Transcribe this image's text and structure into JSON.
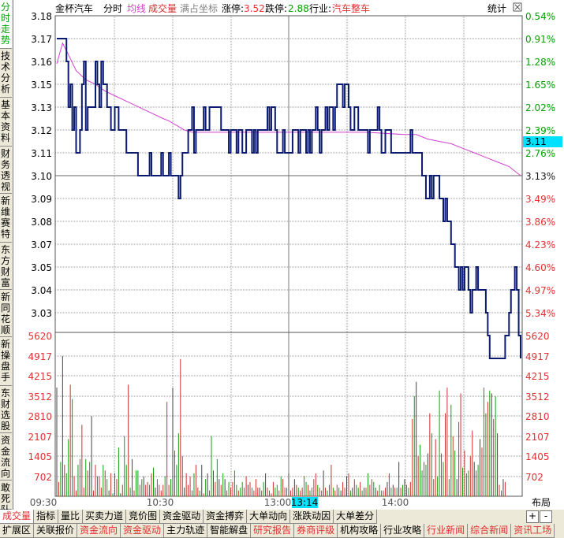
{
  "header": {
    "stock_name": "金杯汽车",
    "view": "分时",
    "avg_line_label": "均线",
    "volume_label": "成交量",
    "fill_coord_label": "满占坐标",
    "limit_up_label": "涨停:",
    "limit_up_value": "3.52",
    "limit_down_label": "跌停:",
    "limit_down_value": "2.88",
    "industry_label": "行业:",
    "industry_value": "汽车整车",
    "stats_label": "统计",
    "layout_label": "布局",
    "plus": "+",
    "minus": "-"
  },
  "side_tabs": [
    "分时走势",
    "技术分析",
    "基本资料",
    "财务透视",
    "新维赛特",
    "东方财富",
    "新同花顺",
    "新操盘手",
    "东财选股",
    "资金流向",
    "敢死队"
  ],
  "bottom_tabs_row1": [
    "成交量",
    "指标",
    "量比",
    "买卖力道",
    "竞价图",
    "资金驱动",
    "资金搏弈",
    "大单动向",
    "涨跌动因",
    "大单差分"
  ],
  "bottom_tabs_row2": [
    "扩展区",
    "关联报价",
    "资金流向",
    "资金驱动",
    "主力轨迹",
    "智能解盘",
    "研究报告",
    "券商评级",
    "机构攻略",
    "行业攻略",
    "行业新闻",
    "综合新闻",
    "资讯工场"
  ],
  "colors": {
    "price_line": "#0a1a6e",
    "avg_line": "#d040d0",
    "up_axis": "#e03030",
    "down_axis": "#00a000",
    "prev_close_axis": "#1a1a1a",
    "vol_up": "#d03030",
    "vol_down": "#10a010",
    "vol_flat": "#444444",
    "current_tag": "#00e0ff"
  },
  "chart_data": {
    "type": "line",
    "title": "",
    "prev_close": "3.10",
    "current_price_tag": "3.11",
    "price_axis_labels": [
      "3.18",
      "3.17",
      "3.16",
      "3.15",
      "3.13",
      "3.12",
      "3.11",
      "3.10",
      "3.09",
      "3.08",
      "3.07",
      "3.05",
      "3.04",
      "3.03"
    ],
    "pct_axis_labels": [
      "0.54%",
      "0.91%",
      "1.28%",
      "1.65%",
      "2.02%",
      "2.39%",
      "2.76%",
      "3.13%",
      "3.49%",
      "3.86%",
      "4.23%",
      "4.60%",
      "4.97%",
      "5.34%"
    ],
    "volume_axis_labels": [
      "5620",
      "4917",
      "4215",
      "3512",
      "2810",
      "2107",
      "1405",
      "702"
    ],
    "volume_max": 5620,
    "time_labels": [
      "09:30",
      "10:30",
      "13:00",
      "14:00"
    ],
    "cursor_time_label": "13:14",
    "minutes_total": 240,
    "price_series": [
      [
        0,
        3.17
      ],
      [
        3,
        3.17
      ],
      [
        5,
        3.16
      ],
      [
        6,
        3.14
      ],
      [
        7,
        3.15
      ],
      [
        8,
        3.13
      ],
      [
        9,
        3.14
      ],
      [
        10,
        3.12
      ],
      [
        11,
        3.12
      ],
      [
        12,
        3.13
      ],
      [
        13,
        3.15
      ],
      [
        14,
        3.16
      ],
      [
        15,
        3.13
      ],
      [
        16,
        3.14
      ],
      [
        17,
        3.14
      ],
      [
        18,
        3.14
      ],
      [
        19,
        3.14
      ],
      [
        20,
        3.16
      ],
      [
        21,
        3.15
      ],
      [
        22,
        3.14
      ],
      [
        23,
        3.16
      ],
      [
        24,
        3.15
      ],
      [
        25,
        3.15
      ],
      [
        26,
        3.14
      ],
      [
        27,
        3.14
      ],
      [
        28,
        3.13
      ],
      [
        29,
        3.13
      ],
      [
        30,
        3.14
      ],
      [
        32,
        3.13
      ],
      [
        34,
        3.13
      ],
      [
        36,
        3.12
      ],
      [
        38,
        3.12
      ],
      [
        40,
        3.12
      ],
      [
        42,
        3.11
      ],
      [
        44,
        3.11
      ],
      [
        46,
        3.11
      ],
      [
        48,
        3.12
      ],
      [
        49,
        3.11
      ],
      [
        52,
        3.11
      ],
      [
        54,
        3.12
      ],
      [
        55,
        3.11
      ],
      [
        56,
        3.11
      ],
      [
        58,
        3.12
      ],
      [
        59,
        3.11
      ],
      [
        61,
        3.11
      ],
      [
        62,
        3.11
      ],
      [
        63,
        3.1
      ],
      [
        64,
        3.11
      ],
      [
        65,
        3.12
      ],
      [
        66,
        3.12
      ],
      [
        67,
        3.12
      ],
      [
        68,
        3.13
      ],
      [
        70,
        3.14
      ],
      [
        71,
        3.12
      ],
      [
        72,
        3.13
      ],
      [
        74,
        3.13
      ],
      [
        75,
        3.13
      ],
      [
        76,
        3.14
      ],
      [
        77,
        3.13
      ],
      [
        78,
        3.13
      ],
      [
        79,
        3.14
      ],
      [
        81,
        3.14
      ],
      [
        84,
        3.14
      ],
      [
        85,
        3.13
      ],
      [
        86,
        3.13
      ],
      [
        88,
        3.13
      ],
      [
        89,
        3.12
      ],
      [
        90,
        3.13
      ],
      [
        92,
        3.13
      ],
      [
        93,
        3.12
      ],
      [
        94,
        3.13
      ],
      [
        95,
        3.13
      ],
      [
        96,
        3.12
      ],
      [
        98,
        3.13
      ],
      [
        100,
        3.13
      ],
      [
        101,
        3.12
      ],
      [
        102,
        3.13
      ],
      [
        103,
        3.12
      ],
      [
        104,
        3.13
      ],
      [
        106,
        3.13
      ],
      [
        108,
        3.13
      ],
      [
        109,
        3.14
      ],
      [
        110,
        3.13
      ],
      [
        111,
        3.14
      ],
      [
        112,
        3.14
      ],
      [
        113,
        3.13
      ],
      [
        114,
        3.12
      ],
      [
        116,
        3.12
      ],
      [
        117,
        3.13
      ],
      [
        118,
        3.12
      ],
      [
        120,
        3.12
      ],
      [
        121,
        3.12
      ],
      [
        122,
        3.13
      ],
      [
        124,
        3.13
      ],
      [
        125,
        3.12
      ],
      [
        126,
        3.13
      ],
      [
        128,
        3.13
      ],
      [
        129,
        3.12
      ],
      [
        130,
        3.13
      ],
      [
        131,
        3.12
      ],
      [
        132,
        3.13
      ],
      [
        133,
        3.13
      ],
      [
        134,
        3.14
      ],
      [
        135,
        3.13
      ],
      [
        136,
        3.12
      ],
      [
        137,
        3.13
      ],
      [
        138,
        3.13
      ],
      [
        139,
        3.14
      ],
      [
        140,
        3.13
      ],
      [
        141,
        3.14
      ],
      [
        142,
        3.14
      ],
      [
        143,
        3.13
      ],
      [
        144,
        3.14
      ],
      [
        145,
        3.15
      ],
      [
        147,
        3.15
      ],
      [
        148,
        3.14
      ],
      [
        149,
        3.15
      ],
      [
        150,
        3.15
      ],
      [
        151,
        3.14
      ],
      [
        152,
        3.13
      ],
      [
        153,
        3.13
      ],
      [
        154,
        3.14
      ],
      [
        156,
        3.13
      ],
      [
        158,
        3.13
      ],
      [
        160,
        3.13
      ],
      [
        161,
        3.12
      ],
      [
        162,
        3.13
      ],
      [
        163,
        3.13
      ],
      [
        164,
        3.13
      ],
      [
        165,
        3.13
      ],
      [
        166,
        3.14
      ],
      [
        167,
        3.13
      ],
      [
        168,
        3.12
      ],
      [
        170,
        3.13
      ],
      [
        172,
        3.13
      ],
      [
        173,
        3.12
      ],
      [
        174,
        3.12
      ],
      [
        176,
        3.12
      ],
      [
        178,
        3.12
      ],
      [
        180,
        3.12
      ],
      [
        182,
        3.12
      ],
      [
        183,
        3.13
      ],
      [
        184,
        3.12
      ],
      [
        186,
        3.12
      ],
      [
        188,
        3.12
      ],
      [
        189,
        3.11
      ],
      [
        190,
        3.11
      ],
      [
        191,
        3.1
      ],
      [
        192,
        3.1
      ],
      [
        193,
        3.11
      ],
      [
        194,
        3.1
      ],
      [
        195,
        3.11
      ],
      [
        197,
        3.11
      ],
      [
        198,
        3.1
      ],
      [
        199,
        3.1
      ],
      [
        200,
        3.09
      ],
      [
        201,
        3.1
      ],
      [
        202,
        3.09
      ],
      [
        203,
        3.09
      ],
      [
        204,
        3.08
      ],
      [
        205,
        3.08
      ],
      [
        206,
        3.07
      ],
      [
        207,
        3.07
      ],
      [
        208,
        3.06
      ],
      [
        209,
        3.07
      ],
      [
        210,
        3.06
      ],
      [
        211,
        3.07
      ],
      [
        212,
        3.07
      ],
      [
        213,
        3.06
      ],
      [
        214,
        3.05
      ],
      [
        215,
        3.06
      ],
      [
        216,
        3.06
      ],
      [
        217,
        3.07
      ],
      [
        218,
        3.06
      ],
      [
        219,
        3.06
      ],
      [
        220,
        3.06
      ],
      [
        221,
        3.06
      ],
      [
        222,
        3.05
      ],
      [
        223,
        3.04
      ],
      [
        224,
        3.03
      ],
      [
        225,
        3.03
      ],
      [
        226,
        3.03
      ],
      [
        227,
        3.03
      ],
      [
        228,
        3.03
      ],
      [
        229,
        3.03
      ],
      [
        230,
        3.03
      ],
      [
        231,
        3.03
      ],
      [
        232,
        3.04
      ],
      [
        233,
        3.04
      ],
      [
        234,
        3.05
      ],
      [
        235,
        3.06
      ],
      [
        236,
        3.06
      ],
      [
        237,
        3.07
      ],
      [
        238,
        3.06
      ],
      [
        239,
        3.04
      ],
      [
        240,
        3.03
      ]
    ],
    "avg_series": [
      [
        0,
        3.159
      ],
      [
        3,
        3.168
      ],
      [
        6,
        3.163
      ],
      [
        10,
        3.156
      ],
      [
        15,
        3.152
      ],
      [
        20,
        3.15
      ],
      [
        25,
        3.147
      ],
      [
        30,
        3.145
      ],
      [
        35,
        3.143
      ],
      [
        40,
        3.141
      ],
      [
        45,
        3.139
      ],
      [
        50,
        3.137
      ],
      [
        55,
        3.135
      ],
      [
        58,
        3.134
      ],
      [
        62,
        3.132
      ],
      [
        66,
        3.13
      ],
      [
        70,
        3.129
      ],
      [
        80,
        3.129
      ],
      [
        100,
        3.129
      ],
      [
        120,
        3.129
      ],
      [
        140,
        3.129
      ],
      [
        160,
        3.129
      ],
      [
        180,
        3.128
      ],
      [
        186,
        3.128
      ],
      [
        192,
        3.126
      ],
      [
        198,
        3.125
      ],
      [
        204,
        3.124
      ],
      [
        210,
        3.122
      ],
      [
        216,
        3.12
      ],
      [
        222,
        3.118
      ],
      [
        228,
        3.116
      ],
      [
        234,
        3.114
      ],
      [
        240,
        3.11
      ]
    ],
    "volumes": [
      3800,
      500,
      1200,
      4900,
      1100,
      800,
      2000,
      3900,
      3400,
      700,
      200,
      1100,
      1300,
      2500,
      300,
      1300,
      900,
      1200,
      2800,
      200,
      1100,
      700,
      700,
      300,
      1100,
      900,
      600,
      200,
      800,
      100,
      800,
      600,
      1700,
      100,
      400,
      2100,
      1100,
      3900,
      300,
      1300,
      200,
      900,
      900,
      400,
      600,
      700,
      400,
      500,
      400,
      800,
      1000,
      300,
      600,
      400,
      200,
      400,
      700,
      3300,
      400,
      600,
      3800,
      1600,
      1100,
      2200,
      4800,
      1400,
      300,
      800,
      400,
      700,
      200,
      800,
      1100,
      300,
      200,
      1100,
      100,
      600,
      800,
      200,
      2100,
      900,
      500,
      1300,
      600,
      400,
      800,
      600,
      200,
      500,
      300,
      500,
      900,
      400,
      200,
      300,
      500,
      300,
      700,
      400,
      500,
      300,
      200,
      600,
      300,
      300,
      200,
      500,
      800,
      300,
      200,
      100,
      500,
      300,
      400,
      200,
      700,
      600,
      300,
      300,
      800,
      200,
      300,
      600,
      400,
      300,
      200,
      300,
      700,
      500,
      400,
      200,
      300,
      600,
      800,
      400,
      300,
      200,
      900,
      300,
      200,
      400,
      1100,
      300,
      200,
      400,
      300,
      200,
      500,
      300,
      700,
      800,
      200,
      300,
      600,
      400,
      300,
      500,
      200,
      300,
      300,
      800,
      400,
      600,
      500,
      300,
      200,
      400,
      200,
      200,
      300,
      500,
      800,
      300,
      400,
      300,
      300,
      1200,
      300,
      400,
      600,
      400,
      300,
      500,
      2700,
      3500,
      4000,
      1400,
      1800,
      900,
      1200,
      1100,
      1500,
      2900,
      2200,
      600,
      2000,
      700,
      3700,
      1500,
      1200,
      2900,
      3800,
      600,
      3200,
      2100,
      1600,
      600,
      2600,
      3600,
      1000,
      1600,
      800,
      900,
      1400,
      2300,
      1200,
      900,
      1100,
      2000,
      1700,
      3800,
      2900,
      3300,
      3700,
      3600,
      2700,
      3500,
      2200,
      400,
      200,
      600,
      500
    ],
    "xlabel": "",
    "ylabel": ""
  }
}
